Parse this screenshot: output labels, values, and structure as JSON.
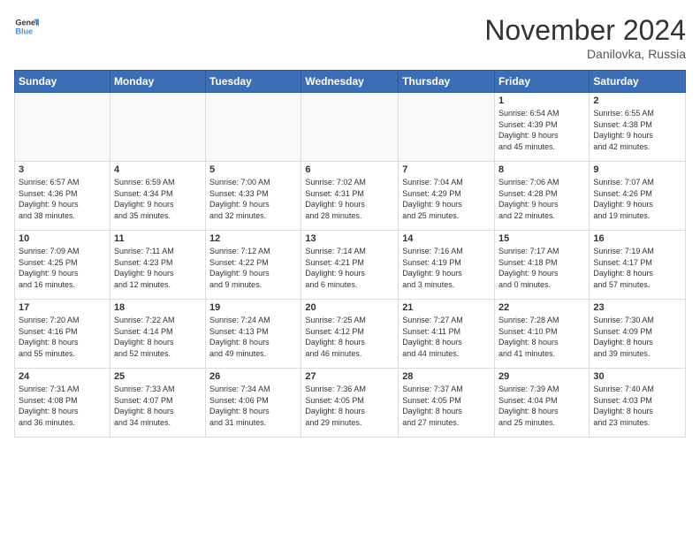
{
  "header": {
    "logo_general": "General",
    "logo_blue": "Blue",
    "month_title": "November 2024",
    "location": "Danilovka, Russia"
  },
  "weekdays": [
    "Sunday",
    "Monday",
    "Tuesday",
    "Wednesday",
    "Thursday",
    "Friday",
    "Saturday"
  ],
  "weeks": [
    [
      {
        "day": "",
        "info": ""
      },
      {
        "day": "",
        "info": ""
      },
      {
        "day": "",
        "info": ""
      },
      {
        "day": "",
        "info": ""
      },
      {
        "day": "",
        "info": ""
      },
      {
        "day": "1",
        "info": "Sunrise: 6:54 AM\nSunset: 4:39 PM\nDaylight: 9 hours\nand 45 minutes."
      },
      {
        "day": "2",
        "info": "Sunrise: 6:55 AM\nSunset: 4:38 PM\nDaylight: 9 hours\nand 42 minutes."
      }
    ],
    [
      {
        "day": "3",
        "info": "Sunrise: 6:57 AM\nSunset: 4:36 PM\nDaylight: 9 hours\nand 38 minutes."
      },
      {
        "day": "4",
        "info": "Sunrise: 6:59 AM\nSunset: 4:34 PM\nDaylight: 9 hours\nand 35 minutes."
      },
      {
        "day": "5",
        "info": "Sunrise: 7:00 AM\nSunset: 4:33 PM\nDaylight: 9 hours\nand 32 minutes."
      },
      {
        "day": "6",
        "info": "Sunrise: 7:02 AM\nSunset: 4:31 PM\nDaylight: 9 hours\nand 28 minutes."
      },
      {
        "day": "7",
        "info": "Sunrise: 7:04 AM\nSunset: 4:29 PM\nDaylight: 9 hours\nand 25 minutes."
      },
      {
        "day": "8",
        "info": "Sunrise: 7:06 AM\nSunset: 4:28 PM\nDaylight: 9 hours\nand 22 minutes."
      },
      {
        "day": "9",
        "info": "Sunrise: 7:07 AM\nSunset: 4:26 PM\nDaylight: 9 hours\nand 19 minutes."
      }
    ],
    [
      {
        "day": "10",
        "info": "Sunrise: 7:09 AM\nSunset: 4:25 PM\nDaylight: 9 hours\nand 16 minutes."
      },
      {
        "day": "11",
        "info": "Sunrise: 7:11 AM\nSunset: 4:23 PM\nDaylight: 9 hours\nand 12 minutes."
      },
      {
        "day": "12",
        "info": "Sunrise: 7:12 AM\nSunset: 4:22 PM\nDaylight: 9 hours\nand 9 minutes."
      },
      {
        "day": "13",
        "info": "Sunrise: 7:14 AM\nSunset: 4:21 PM\nDaylight: 9 hours\nand 6 minutes."
      },
      {
        "day": "14",
        "info": "Sunrise: 7:16 AM\nSunset: 4:19 PM\nDaylight: 9 hours\nand 3 minutes."
      },
      {
        "day": "15",
        "info": "Sunrise: 7:17 AM\nSunset: 4:18 PM\nDaylight: 9 hours\nand 0 minutes."
      },
      {
        "day": "16",
        "info": "Sunrise: 7:19 AM\nSunset: 4:17 PM\nDaylight: 8 hours\nand 57 minutes."
      }
    ],
    [
      {
        "day": "17",
        "info": "Sunrise: 7:20 AM\nSunset: 4:16 PM\nDaylight: 8 hours\nand 55 minutes."
      },
      {
        "day": "18",
        "info": "Sunrise: 7:22 AM\nSunset: 4:14 PM\nDaylight: 8 hours\nand 52 minutes."
      },
      {
        "day": "19",
        "info": "Sunrise: 7:24 AM\nSunset: 4:13 PM\nDaylight: 8 hours\nand 49 minutes."
      },
      {
        "day": "20",
        "info": "Sunrise: 7:25 AM\nSunset: 4:12 PM\nDaylight: 8 hours\nand 46 minutes."
      },
      {
        "day": "21",
        "info": "Sunrise: 7:27 AM\nSunset: 4:11 PM\nDaylight: 8 hours\nand 44 minutes."
      },
      {
        "day": "22",
        "info": "Sunrise: 7:28 AM\nSunset: 4:10 PM\nDaylight: 8 hours\nand 41 minutes."
      },
      {
        "day": "23",
        "info": "Sunrise: 7:30 AM\nSunset: 4:09 PM\nDaylight: 8 hours\nand 39 minutes."
      }
    ],
    [
      {
        "day": "24",
        "info": "Sunrise: 7:31 AM\nSunset: 4:08 PM\nDaylight: 8 hours\nand 36 minutes."
      },
      {
        "day": "25",
        "info": "Sunrise: 7:33 AM\nSunset: 4:07 PM\nDaylight: 8 hours\nand 34 minutes."
      },
      {
        "day": "26",
        "info": "Sunrise: 7:34 AM\nSunset: 4:06 PM\nDaylight: 8 hours\nand 31 minutes."
      },
      {
        "day": "27",
        "info": "Sunrise: 7:36 AM\nSunset: 4:05 PM\nDaylight: 8 hours\nand 29 minutes."
      },
      {
        "day": "28",
        "info": "Sunrise: 7:37 AM\nSunset: 4:05 PM\nDaylight: 8 hours\nand 27 minutes."
      },
      {
        "day": "29",
        "info": "Sunrise: 7:39 AM\nSunset: 4:04 PM\nDaylight: 8 hours\nand 25 minutes."
      },
      {
        "day": "30",
        "info": "Sunrise: 7:40 AM\nSunset: 4:03 PM\nDaylight: 8 hours\nand 23 minutes."
      }
    ]
  ]
}
